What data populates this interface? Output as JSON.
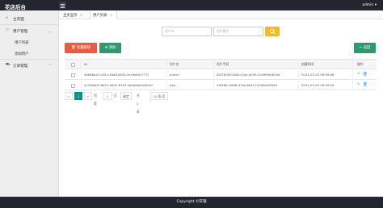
{
  "app": {
    "title": "花店后台",
    "user": "admin"
  },
  "sidebar": {
    "items": [
      {
        "label": "主页面",
        "icon": "home-icon"
      },
      {
        "label": "用户管理",
        "icon": "user-icon"
      },
      {
        "label": "用户列表"
      },
      {
        "label": "添加用户"
      },
      {
        "label": "订单管理",
        "icon": "cart-icon"
      }
    ]
  },
  "tabs": [
    {
      "label": "主页显示",
      "close": "×"
    },
    {
      "label": "用户列表",
      "close": "×"
    }
  ],
  "search": {
    "id_placeholder": "用户ID",
    "account_placeholder": "用户账号"
  },
  "toolbar": {
    "batch_delete": "批量删除",
    "add": "添加",
    "back": "返回"
  },
  "table": {
    "columns": [
      "ID",
      "用户名",
      "用户手机",
      "创建时间",
      "操作"
    ],
    "rows": [
      {
        "id": "4e6d8a41-c054-4ba8-803a-5cceeb5c777f",
        "username": "admin",
        "phone": "00f7678f-00a8-41bc-a059-2cd9f0e0b59d",
        "created": "2021-02-04 09:09:08"
      },
      {
        "id": "a716b503-8d21-4802-8343-4a4e6ae5a5b4d",
        "username": "aaa",
        "phone": "09f48fc-06d8-47aa-8d1f-72c60d40f59d",
        "created": "2021-02-04 09:09:09"
      }
    ]
  },
  "pagination": {
    "prev": "<",
    "current": "1",
    "next": ">",
    "goto_label": "到第",
    "page_input": "1",
    "page_unit": "页",
    "confirm": "确定",
    "total": "共 2 条",
    "per_page": "10 条/页"
  },
  "footer": {
    "text": "Copyright ©轩辕"
  }
}
